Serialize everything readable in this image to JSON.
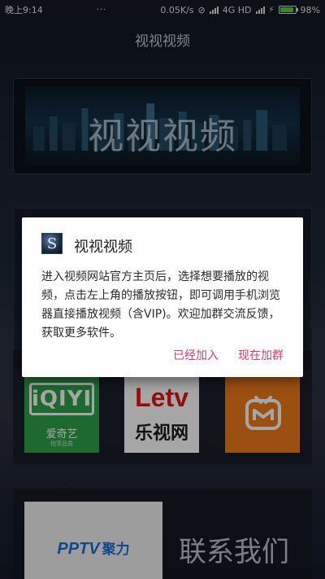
{
  "status_bar": {
    "time": "晚上9:14",
    "speed": "0.05K/s",
    "network": "4G HD",
    "battery": "98%",
    "icons": [
      "dots-icon",
      "no-sync-icon",
      "signal-icon",
      "battery-icon",
      "bolt-icon"
    ]
  },
  "app": {
    "title": "视视视频"
  },
  "banner": {
    "text": "视视视频"
  },
  "tiles": {
    "iqiyi": {
      "logo": "iQIYI",
      "name": "爱奇艺",
      "sub": "悦享品质",
      "color": "#2ea24b"
    },
    "letv": {
      "logo": "Letv",
      "name": "乐视网",
      "color": "#e0161b"
    },
    "mgtv": {
      "color": "#ef7a1a"
    }
  },
  "bottom": {
    "pptv_logo": "PPTV",
    "pptv_cn": "聚力",
    "contact": "联系我们"
  },
  "dialog": {
    "title": "视视视频",
    "icon_letter": "S",
    "message": "进入视频网站官方主页后，选择想要播放的视频，点击左上角的播放按钮，即可调用手机浏览器直接播放视频（含VIP)。欢迎加群交流反馈，获取更多软件。",
    "cancel_label": "已经加入",
    "confirm_label": "现在加群",
    "accent": "#e1366a"
  }
}
